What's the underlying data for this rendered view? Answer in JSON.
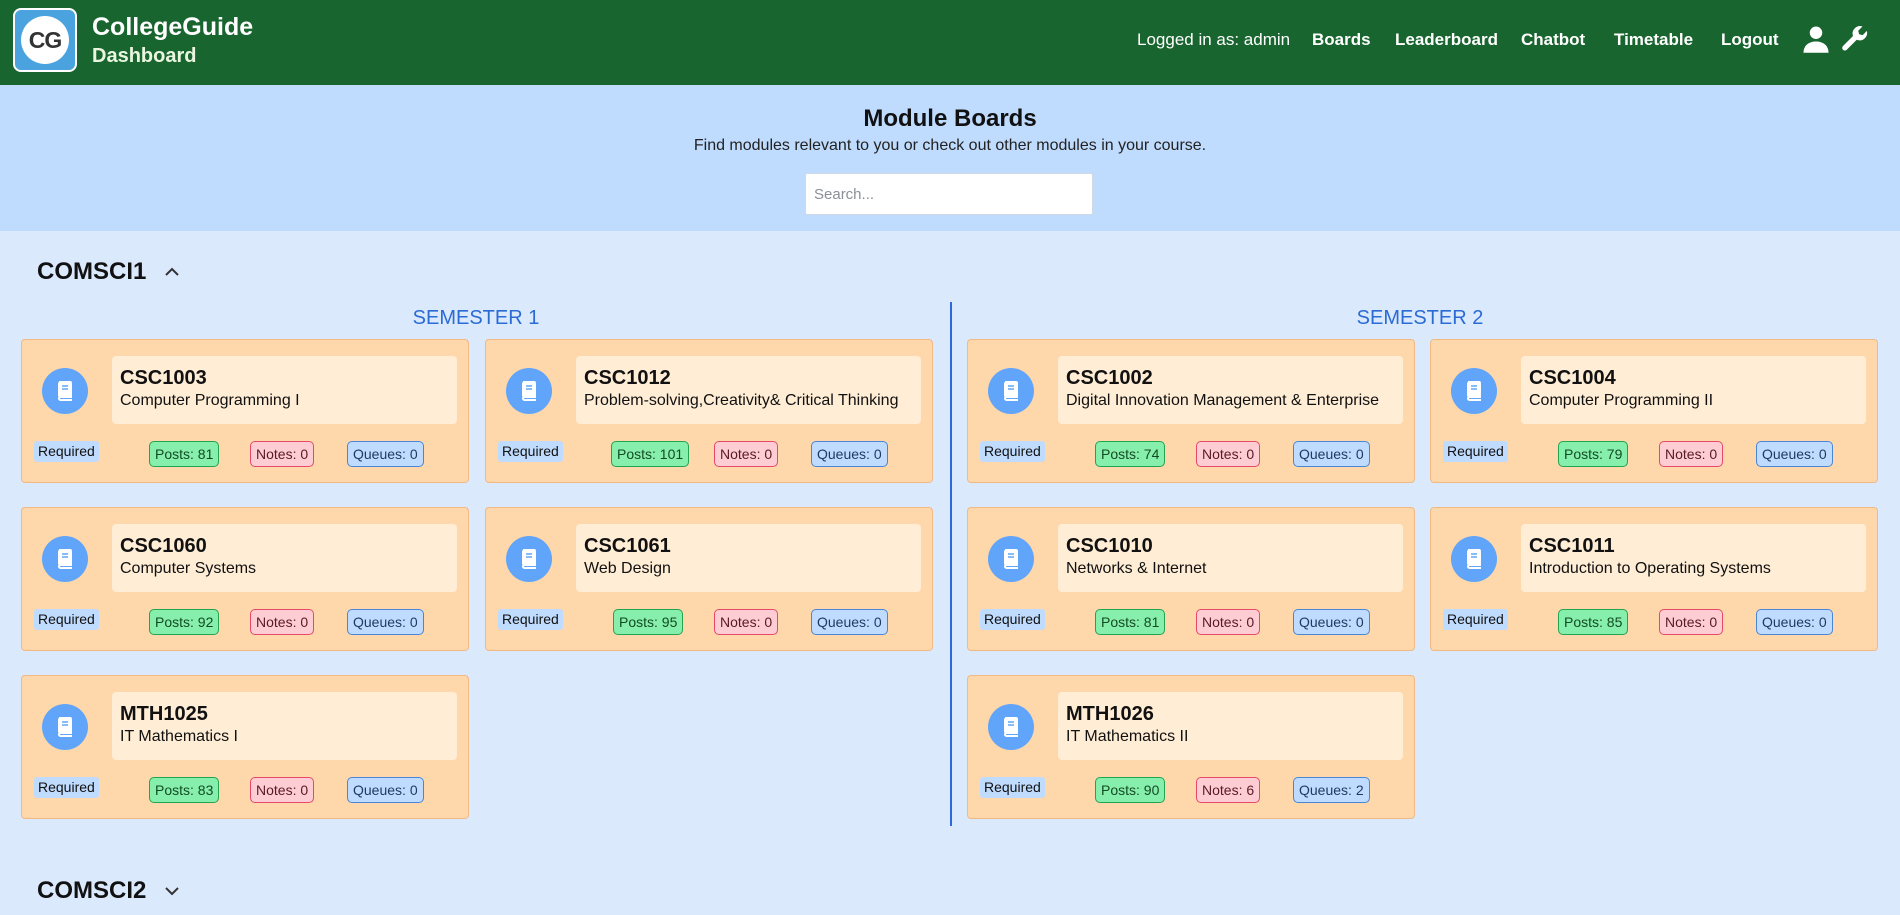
{
  "header": {
    "logo_text": "CG",
    "brand_name": "CollegeGuide",
    "brand_sub": "Dashboard",
    "login_text": "Logged in as: admin",
    "nav": [
      "Boards",
      "Leaderboard",
      "Chatbot",
      "Timetable",
      "Logout"
    ],
    "icons": [
      "user-icon",
      "wrench-icon"
    ]
  },
  "hero": {
    "title": "Module Boards",
    "subtitle": "Find modules relevant to you or check out other modules in your course.",
    "search_placeholder": "Search..."
  },
  "courses": [
    {
      "name": "COMSCI1",
      "expanded": true,
      "semesters": [
        {
          "title": "SEMESTER 1",
          "modules": [
            {
              "code": "CSC1003",
              "title": "Computer Programming I",
              "tag": "Required",
              "posts": "Posts: 81",
              "notes": "Notes: 0",
              "queues": "Queues: 0"
            },
            {
              "code": "CSC1012",
              "title": "Problem-solving,Creativity& Critical Thinking",
              "tag": "Required",
              "posts": "Posts: 101",
              "notes": "Notes: 0",
              "queues": "Queues: 0"
            },
            {
              "code": "CSC1060",
              "title": "Computer Systems",
              "tag": "Required",
              "posts": "Posts: 92",
              "notes": "Notes: 0",
              "queues": "Queues: 0"
            },
            {
              "code": "CSC1061",
              "title": "Web Design",
              "tag": "Required",
              "posts": "Posts: 95",
              "notes": "Notes: 0",
              "queues": "Queues: 0"
            },
            {
              "code": "MTH1025",
              "title": "IT Mathematics I",
              "tag": "Required",
              "posts": "Posts: 83",
              "notes": "Notes: 0",
              "queues": "Queues: 0"
            }
          ]
        },
        {
          "title": "SEMESTER 2",
          "modules": [
            {
              "code": "CSC1002",
              "title": "Digital Innovation Management & Enterprise",
              "tag": "Required",
              "posts": "Posts: 74",
              "notes": "Notes: 0",
              "queues": "Queues: 0"
            },
            {
              "code": "CSC1004",
              "title": "Computer Programming II",
              "tag": "Required",
              "posts": "Posts: 79",
              "notes": "Notes: 0",
              "queues": "Queues: 0"
            },
            {
              "code": "CSC1010",
              "title": "Networks & Internet",
              "tag": "Required",
              "posts": "Posts: 81",
              "notes": "Notes: 0",
              "queues": "Queues: 0"
            },
            {
              "code": "CSC1011",
              "title": "Introduction to Operating Systems",
              "tag": "Required",
              "posts": "Posts: 85",
              "notes": "Notes: 0",
              "queues": "Queues: 0"
            },
            {
              "code": "MTH1026",
              "title": "IT Mathematics II",
              "tag": "Required",
              "posts": "Posts: 90",
              "notes": "Notes: 6",
              "queues": "Queues: 2"
            }
          ]
        }
      ]
    },
    {
      "name": "COMSCI2",
      "expanded": false
    }
  ],
  "colors": {
    "header_bg": "#19652f",
    "hero_bg": "#bfdbfe",
    "page_bg": "#dbe9fd",
    "card_bg": "#fed7aa",
    "semester_accent": "#2a6bd6"
  }
}
